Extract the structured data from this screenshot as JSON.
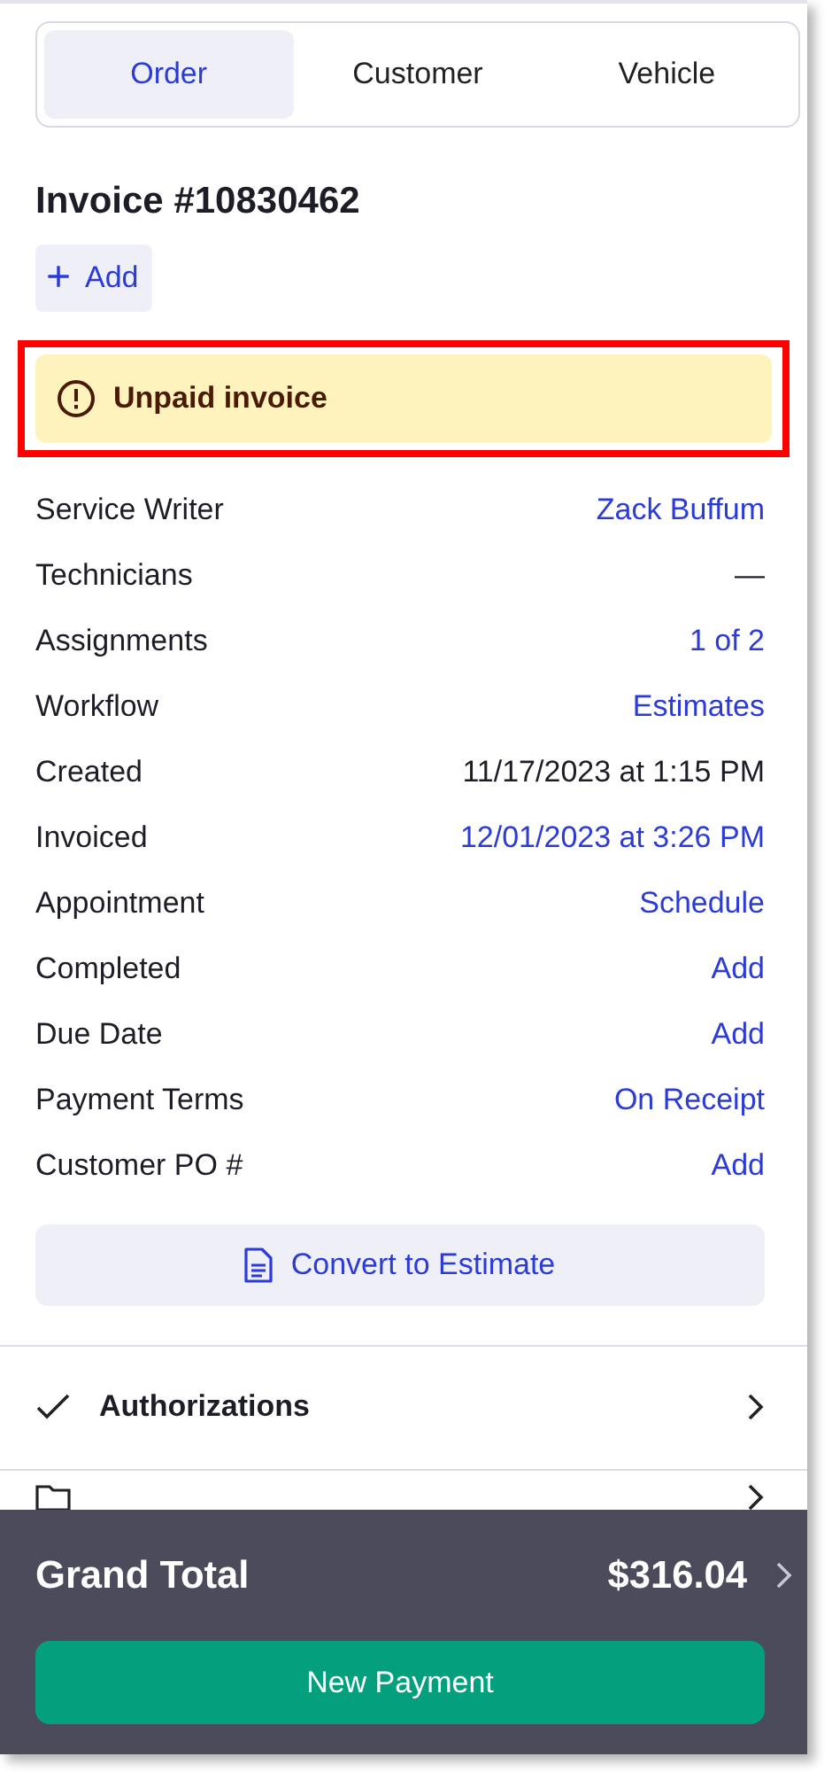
{
  "tabs": [
    {
      "label": "Order",
      "selected": true
    },
    {
      "label": "Customer",
      "selected": false
    },
    {
      "label": "Vehicle",
      "selected": false
    }
  ],
  "title": "Invoice #10830462",
  "add_button": {
    "icon": "+",
    "label": "Add"
  },
  "alert": {
    "text": "Unpaid invoice",
    "highlighted": true
  },
  "details": [
    {
      "label": "Service Writer",
      "value": "Zack Buffum",
      "kind": "link"
    },
    {
      "label": "Technicians",
      "value": "—",
      "kind": "text"
    },
    {
      "label": "Assignments",
      "value": "1 of 2",
      "kind": "link"
    },
    {
      "label": "Workflow",
      "value": "Estimates",
      "kind": "link"
    },
    {
      "label": "Created",
      "value": "11/17/2023 at 1:15 PM",
      "kind": "text"
    },
    {
      "label": "Invoiced",
      "value": "12/01/2023 at 3:26 PM",
      "kind": "link"
    },
    {
      "label": "Appointment",
      "value": "Schedule",
      "kind": "link"
    },
    {
      "label": "Completed",
      "value": "Add",
      "kind": "link"
    },
    {
      "label": "Due Date",
      "value": "Add",
      "kind": "link"
    },
    {
      "label": "Payment Terms",
      "value": "On Receipt",
      "kind": "link"
    },
    {
      "label": "Customer PO #",
      "value": "Add",
      "kind": "link"
    }
  ],
  "convert_button": "Convert to Estimate",
  "sections": [
    {
      "label": "Authorizations",
      "kind": "check"
    },
    {
      "kind": "folder"
    }
  ],
  "footer": {
    "label": "Grand Total",
    "amount": "$316.04",
    "button": "New Payment"
  }
}
